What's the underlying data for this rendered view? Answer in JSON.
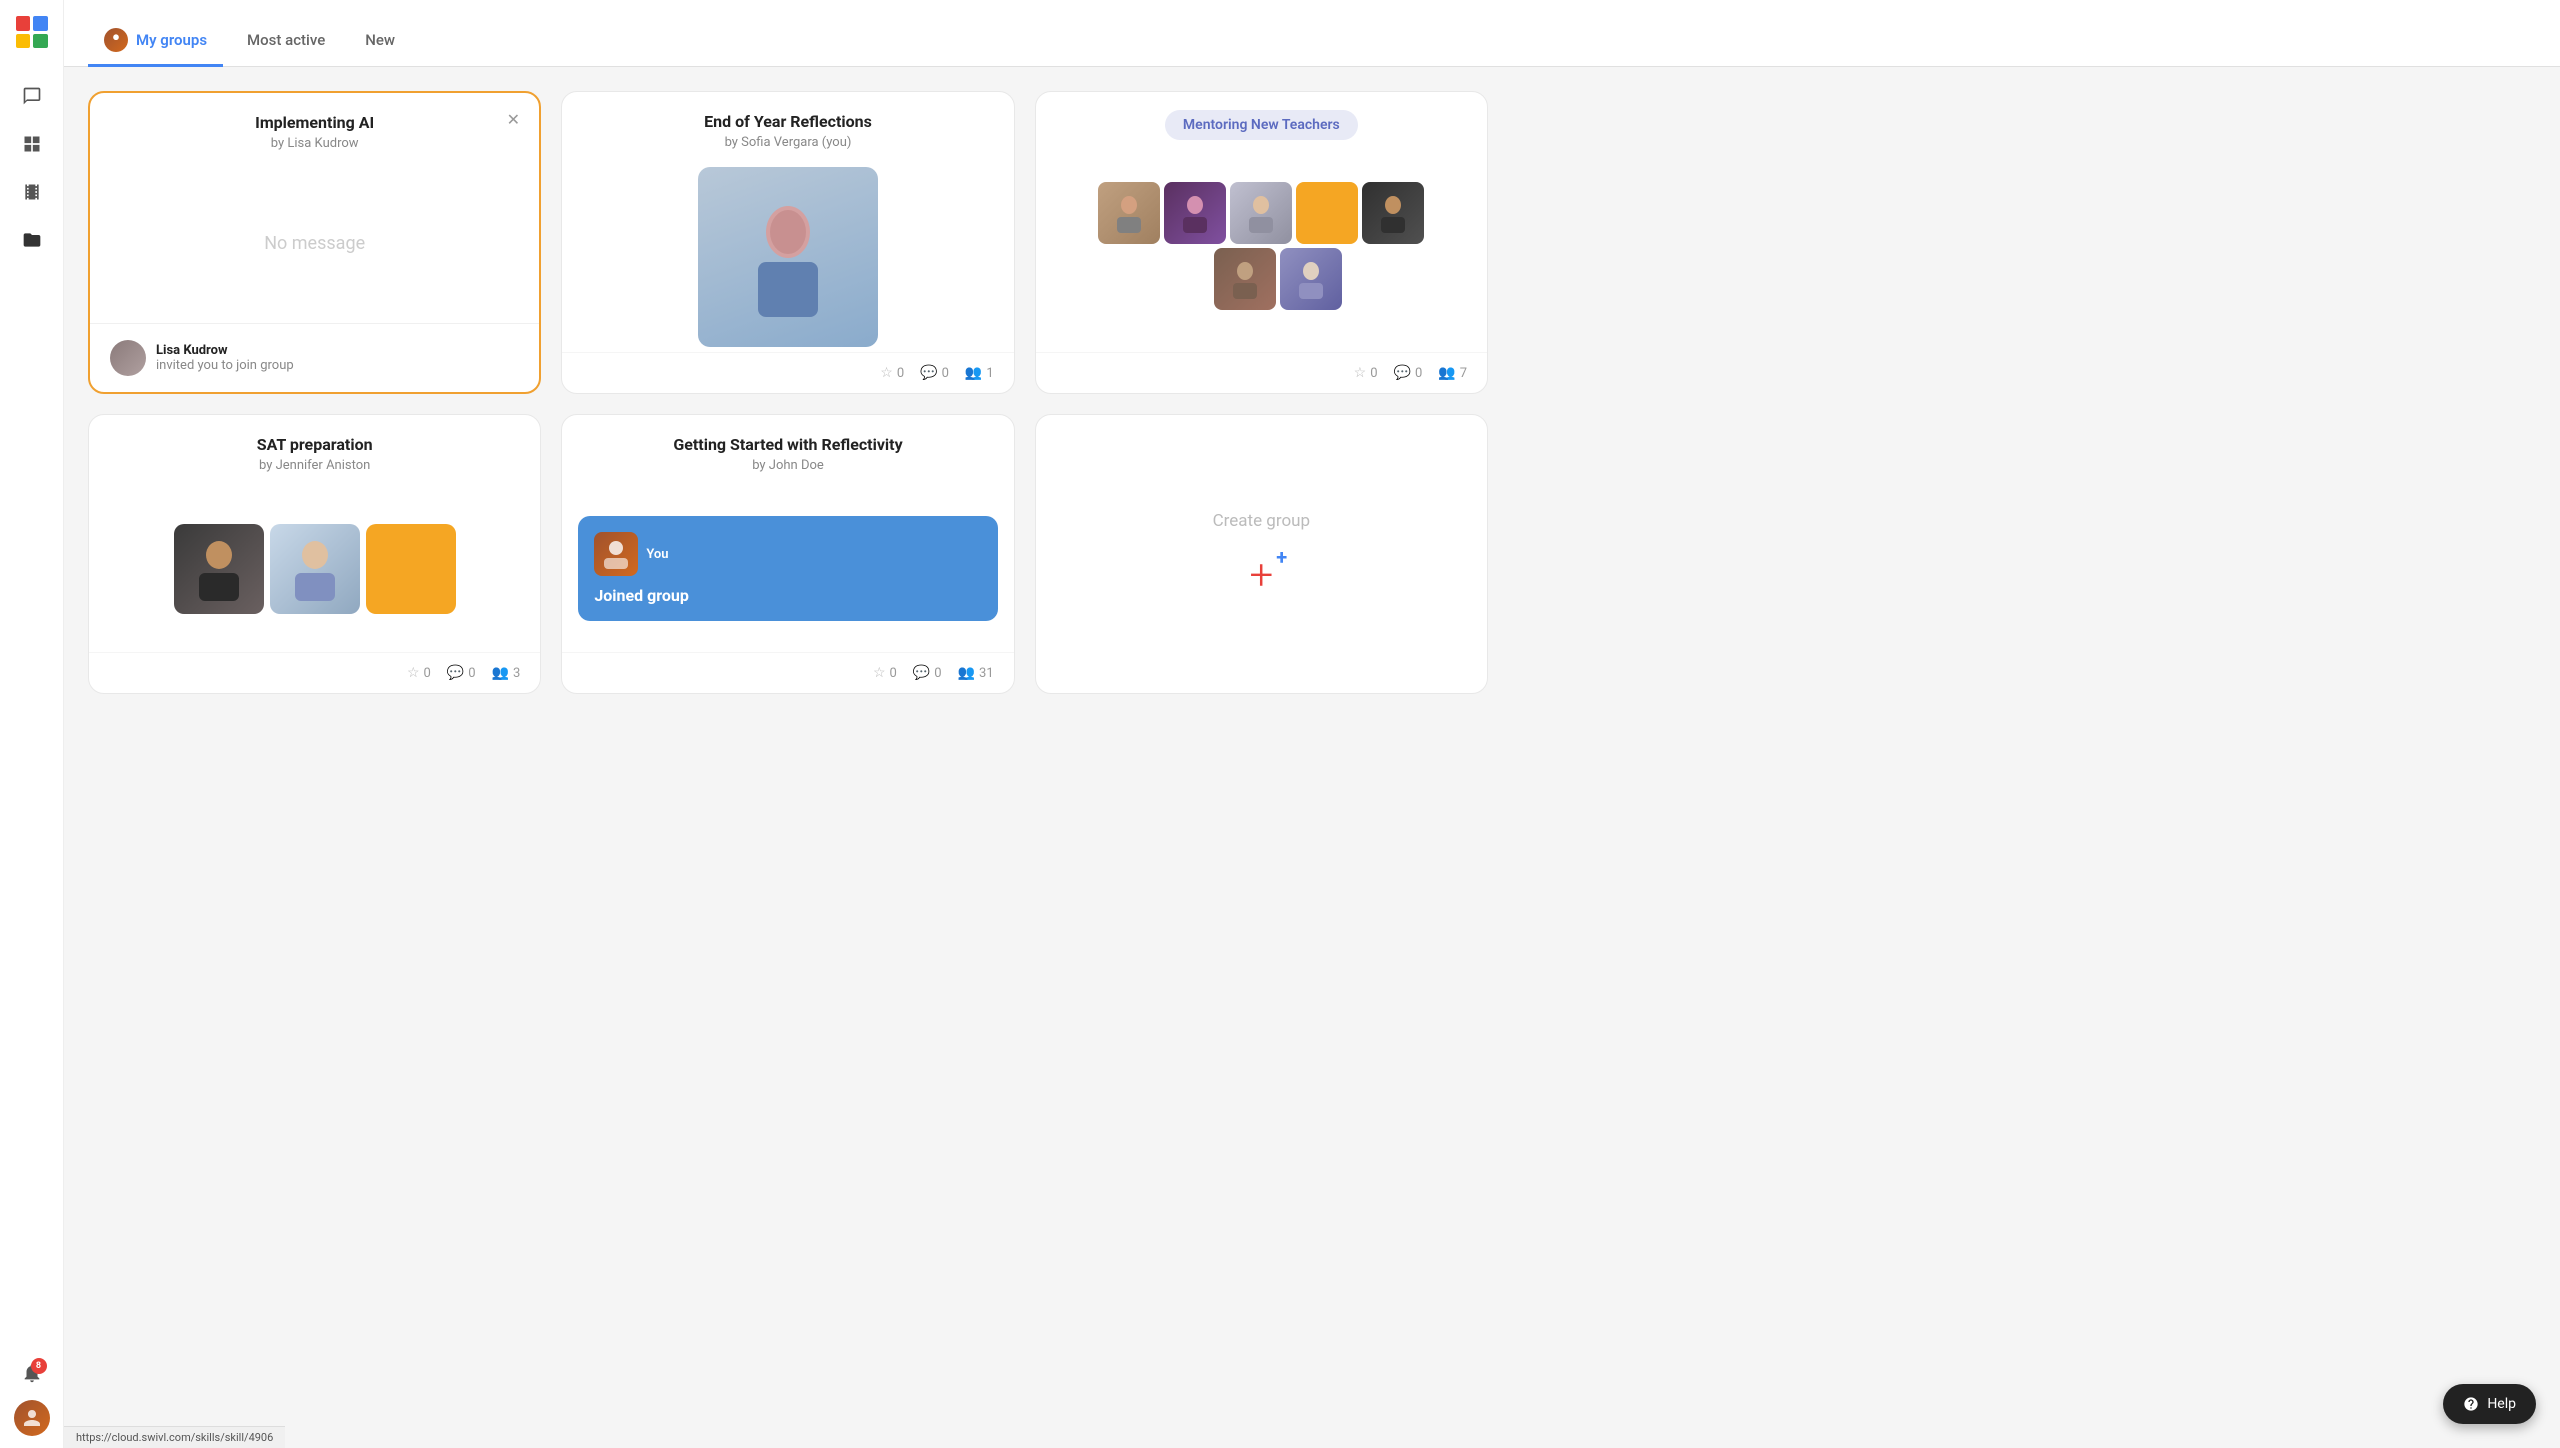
{
  "app": {
    "logo_cells": [
      "red",
      "blue",
      "yellow",
      "green"
    ]
  },
  "sidebar": {
    "icons": [
      {
        "name": "chat-icon",
        "symbol": "💬"
      },
      {
        "name": "grid-icon",
        "symbol": "⊞"
      },
      {
        "name": "film-icon",
        "symbol": "🎞"
      },
      {
        "name": "folder-icon",
        "symbol": "📁"
      }
    ],
    "notification_count": "8",
    "bell_icon": "🔔"
  },
  "tabs": [
    {
      "id": "my-groups",
      "label": "My groups",
      "active": true,
      "has_icon": true
    },
    {
      "id": "most-active",
      "label": "Most active",
      "active": false,
      "has_icon": false
    },
    {
      "id": "new",
      "label": "New",
      "active": false,
      "has_icon": false
    }
  ],
  "groups": [
    {
      "id": "implementing-ai",
      "title": "Implementing AI",
      "subtitle": "by Lisa Kudrow",
      "body_type": "no_message",
      "no_message_text": "No message",
      "has_close": true,
      "highlighted": true,
      "footer_type": "invite",
      "inviter_name": "Lisa Kudrow",
      "invite_text": "invited you to join group",
      "stars": null,
      "comments": null,
      "members": null
    },
    {
      "id": "end-of-year",
      "title": "End of Year Reflections",
      "subtitle": "by Sofia Vergara (you)",
      "body_type": "person_photo",
      "footer_type": "stats",
      "stars": "0",
      "comments": "0",
      "members": "1"
    },
    {
      "id": "mentoring-new-teachers",
      "title": "Mentoring New Teachers",
      "subtitle": "",
      "body_type": "mosaic_mentoring",
      "badge_text": "Mentoring New Teachers",
      "footer_type": "stats",
      "stars": "0",
      "comments": "0",
      "members": "7"
    },
    {
      "id": "sat-preparation",
      "title": "SAT preparation",
      "subtitle": "by Jennifer Aniston",
      "body_type": "sat_photos",
      "footer_type": "stats",
      "stars": "0",
      "comments": "0",
      "members": "3"
    },
    {
      "id": "getting-started",
      "title": "Getting Started with Reflectivity",
      "subtitle": "by John Doe",
      "body_type": "joined_message",
      "joined_text": "Joined group",
      "footer_type": "stats",
      "stars": "0",
      "comments": "0",
      "members": "31"
    },
    {
      "id": "create-group",
      "title": "Create group",
      "body_type": "create",
      "footer_type": "none"
    }
  ],
  "help": {
    "label": "Help"
  },
  "status_bar": {
    "url": "https://cloud.swivl.com/skills/skill/4906"
  }
}
